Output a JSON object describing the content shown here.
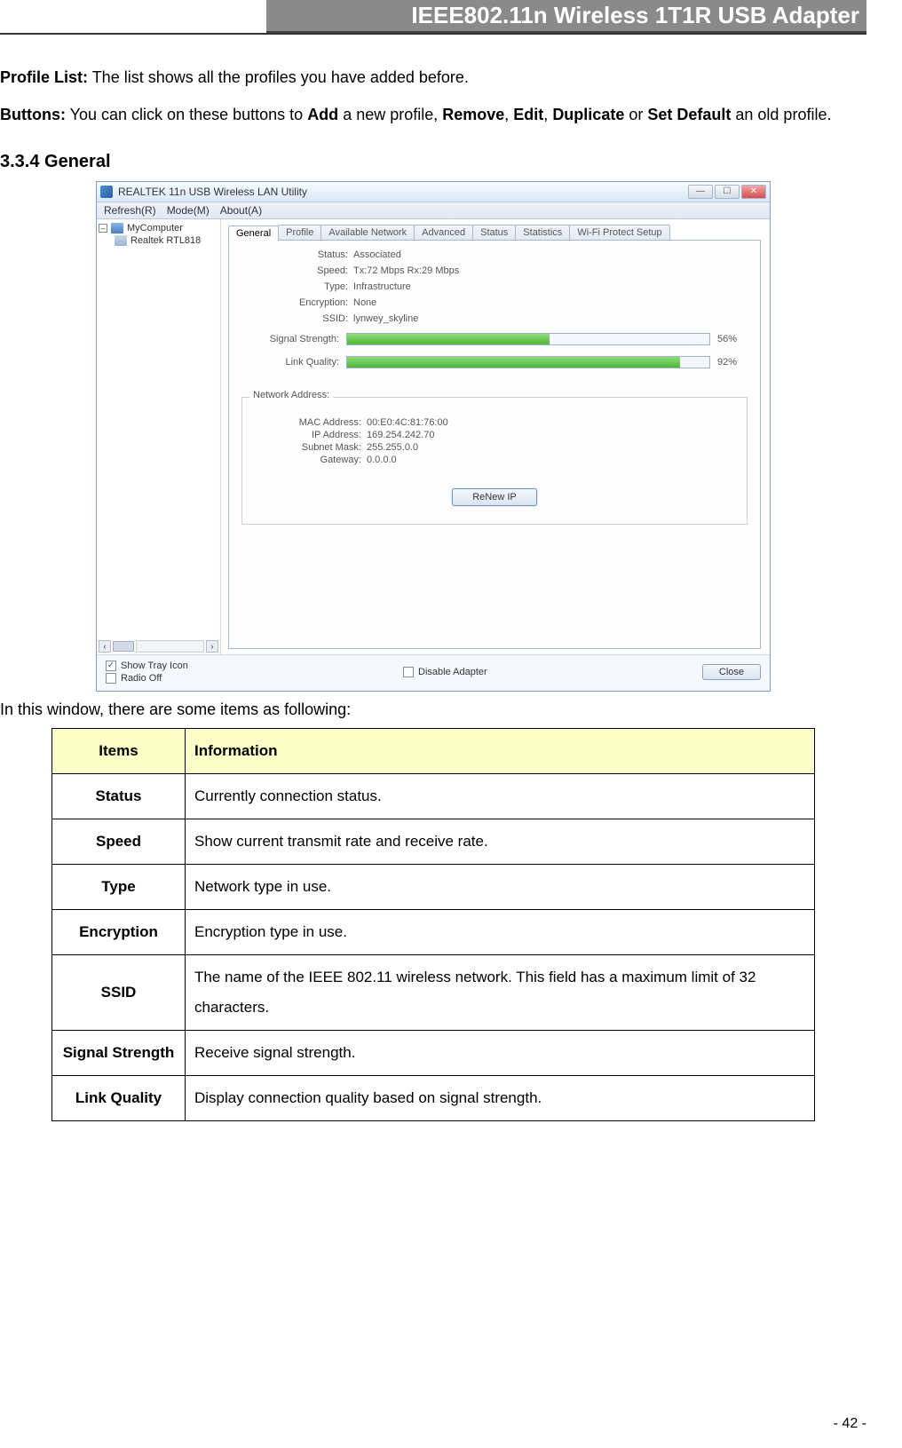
{
  "header": {
    "title": "IEEE802.11n Wireless 1T1R USB Adapter"
  },
  "intro": {
    "profile_list_label": "Profile List:",
    "profile_list_text": " The list shows all the profiles you have added before.",
    "buttons_label": "Buttons:",
    "buttons_pre": " You can click on these buttons to ",
    "add": "Add",
    "buttons_mid1": " a new profile, ",
    "remove": "Remove",
    "sep1": ", ",
    "edit": "Edit",
    "sep2": ", ",
    "duplicate": "Duplicate",
    "buttons_mid2": " or ",
    "set_default": "Set Default",
    "buttons_end": " an old profile."
  },
  "section": {
    "heading": "3.3.4    General"
  },
  "app": {
    "title": "REALTEK 11n USB Wireless LAN Utility",
    "menus": [
      "Refresh(R)",
      "Mode(M)",
      "About(A)"
    ],
    "tree": {
      "root": "MyComputer",
      "adapter": "Realtek RTL818"
    },
    "tabs": [
      "General",
      "Profile",
      "Available Network",
      "Advanced",
      "Status",
      "Statistics",
      "Wi-Fi Protect Setup"
    ],
    "fields": {
      "status_label": "Status:",
      "status_value": "Associated",
      "speed_label": "Speed:",
      "speed_value": "Tx:72 Mbps Rx:29 Mbps",
      "type_label": "Type:",
      "type_value": "Infrastructure",
      "encryption_label": "Encryption:",
      "encryption_value": "None",
      "ssid_label": "SSID:",
      "ssid_value": "lynwey_skyline"
    },
    "signal": {
      "label": "Signal Strength:",
      "pct": "56%",
      "pct_num": 56
    },
    "link": {
      "label": "Link Quality:",
      "pct": "92%",
      "pct_num": 92
    },
    "netaddr": {
      "legend": "Network Address:",
      "mac_label": "MAC Address:",
      "mac_value": "00:E0:4C:81:76:00",
      "ip_label": "IP Address:",
      "ip_value": "169.254.242.70",
      "subnet_label": "Subnet Mask:",
      "subnet_value": "255.255.0.0",
      "gateway_label": "Gateway:",
      "gateway_value": "0.0.0.0",
      "renew": "ReNew IP"
    },
    "bottom": {
      "show_tray": "Show Tray Icon",
      "radio_off": "Radio Off",
      "disable_adapter": "Disable Adapter",
      "close": "Close"
    }
  },
  "below_text": "In this window, there are some items as following:",
  "table": {
    "head_items": "Items",
    "head_info": "Information",
    "rows": [
      {
        "item": "Status",
        "info": "Currently connection status."
      },
      {
        "item": "Speed",
        "info": "Show current transmit rate and receive rate."
      },
      {
        "item": "Type",
        "info": "Network type in use."
      },
      {
        "item": "Encryption",
        "info": "Encryption type in use."
      },
      {
        "item": "SSID",
        "info": "The name of the IEEE 802.11 wireless network. This field has a maximum limit of 32 characters."
      },
      {
        "item": "Signal Strength",
        "info": "Receive signal strength."
      },
      {
        "item": "Link Quality",
        "info": "Display connection quality based on signal strength."
      }
    ]
  },
  "page_number": "- 42 -"
}
